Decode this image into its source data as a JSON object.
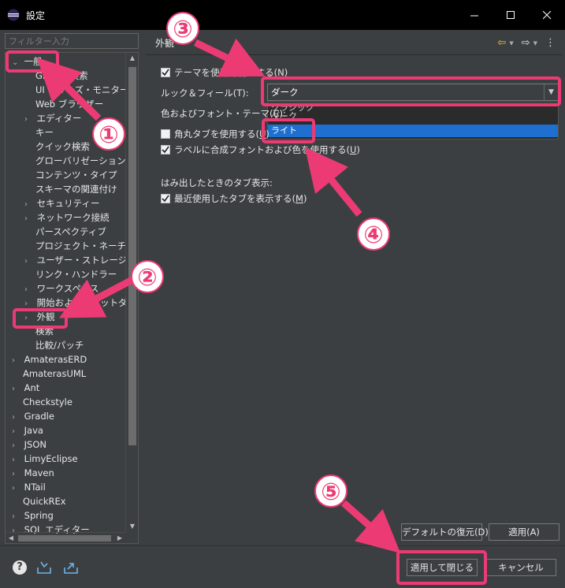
{
  "window": {
    "title": "設定"
  },
  "filter": {
    "placeholder": "フィルター入力"
  },
  "tree": {
    "items": [
      {
        "label": "一般",
        "chevron": "⌄"
      },
      {
        "label": "Glance 検索"
      },
      {
        "label": "UI フリーズ・モニター"
      },
      {
        "label": "Web ブラウザー"
      },
      {
        "label": "エディター",
        "chevron": "›"
      },
      {
        "label": "キー"
      },
      {
        "label": "クイック検索"
      },
      {
        "label": "グローバリゼーション"
      },
      {
        "label": "コンテンツ・タイプ"
      },
      {
        "label": "スキーマの関連付け"
      },
      {
        "label": "セキュリティー",
        "chevron": "›"
      },
      {
        "label": "ネットワーク接続",
        "chevron": "›"
      },
      {
        "label": "パースペクティブ"
      },
      {
        "label": "プロジェクト・ネーチャー"
      },
      {
        "label": "ユーザー・ストレージ・サービス",
        "chevron": "›"
      },
      {
        "label": "リンク・ハンドラー"
      },
      {
        "label": "ワークスペース",
        "chevron": "›"
      },
      {
        "label": "開始およびシャットダウン",
        "chevron": "›"
      },
      {
        "label": "外観",
        "chevron": "›"
      },
      {
        "label": "検索"
      },
      {
        "label": "比較/パッチ"
      },
      {
        "label": "AmaterasERD",
        "chevron": "›"
      },
      {
        "label": "AmaterasUML"
      },
      {
        "label": "Ant",
        "chevron": "›"
      },
      {
        "label": "Checkstyle"
      },
      {
        "label": "Gradle",
        "chevron": "›"
      },
      {
        "label": "Java",
        "chevron": "›"
      },
      {
        "label": "JSON",
        "chevron": "›"
      },
      {
        "label": "LimyEclipse",
        "chevron": "›"
      },
      {
        "label": "Maven",
        "chevron": "›"
      },
      {
        "label": "NTail",
        "chevron": "›"
      },
      {
        "label": "QuickREx"
      },
      {
        "label": "Spring",
        "chevron": "›"
      },
      {
        "label": "SQL エディター",
        "chevron": "›"
      }
    ]
  },
  "page": {
    "title": "外観",
    "enable_theme": {
      "label": "テーマを使用可能にする(",
      "mnemonic": "N",
      "suffix": ")"
    },
    "look_and_feel": {
      "label": "ルック＆フィール(T):",
      "value": "ダーク"
    },
    "options": [
      "クラシック",
      "ダーク",
      "ライト"
    ],
    "color_theme": {
      "label": "色およびフォント・テーマ(C):"
    },
    "rounded_tabs": {
      "label": "角丸タブを使用する(",
      "mnemonic": "U",
      "suffix": ")"
    },
    "mixed_fonts": {
      "label": "ラベルに合成フォントおよび色を使用する(",
      "mnemonic": "U",
      "suffix": ")"
    },
    "tab_overflow": {
      "label": "はみ出したときのタブ表示:"
    },
    "recent_tabs": {
      "label": "最近使用したタブを表示する(",
      "mnemonic": "M",
      "suffix": ")"
    },
    "restore_defaults": "デフォルトの復元(D)",
    "apply": "適用(A)"
  },
  "footer": {
    "apply_close": "適用して閉じる",
    "cancel": "キャンセル"
  },
  "annotations": [
    "①",
    "②",
    "③",
    "④",
    "⑤"
  ],
  "colors": {
    "accent": "#ec3b74",
    "selection": "#1e6fd0",
    "background": "#3c3f41"
  }
}
